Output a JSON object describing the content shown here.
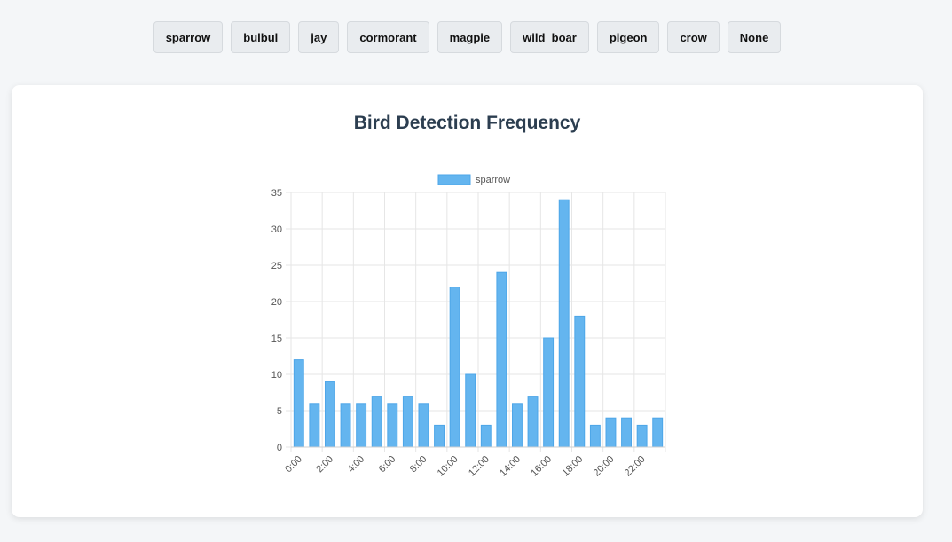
{
  "filters": [
    "sparrow",
    "bulbul",
    "jay",
    "cormorant",
    "magpie",
    "wild_boar",
    "pigeon",
    "crow",
    "None"
  ],
  "bar_color": "#64b5ef",
  "chart_data": {
    "type": "bar",
    "title": "Bird Detection Frequency",
    "xlabel": "",
    "ylabel": "",
    "categories": [
      "0:00",
      "1:00",
      "2:00",
      "3:00",
      "4:00",
      "5:00",
      "6:00",
      "7:00",
      "8:00",
      "9:00",
      "10:00",
      "11:00",
      "12:00",
      "13:00",
      "14:00",
      "15:00",
      "16:00",
      "17:00",
      "18:00",
      "19:00",
      "20:00",
      "21:00",
      "22:00",
      "23:00"
    ],
    "tick_labels": [
      "0:00",
      "2:00",
      "4:00",
      "6:00",
      "8:00",
      "10:00",
      "12:00",
      "14:00",
      "16:00",
      "18:00",
      "20:00",
      "22:00"
    ],
    "series": [
      {
        "name": "sparrow",
        "values": [
          12,
          6,
          9,
          6,
          6,
          7,
          6,
          7,
          6,
          3,
          22,
          10,
          3,
          24,
          6,
          7,
          15,
          34,
          18,
          3,
          4,
          4,
          3,
          4
        ]
      }
    ],
    "ylim": [
      0,
      35
    ],
    "yticks": [
      0,
      5,
      10,
      15,
      20,
      25,
      30,
      35
    ],
    "grid": true,
    "legend": "top"
  }
}
